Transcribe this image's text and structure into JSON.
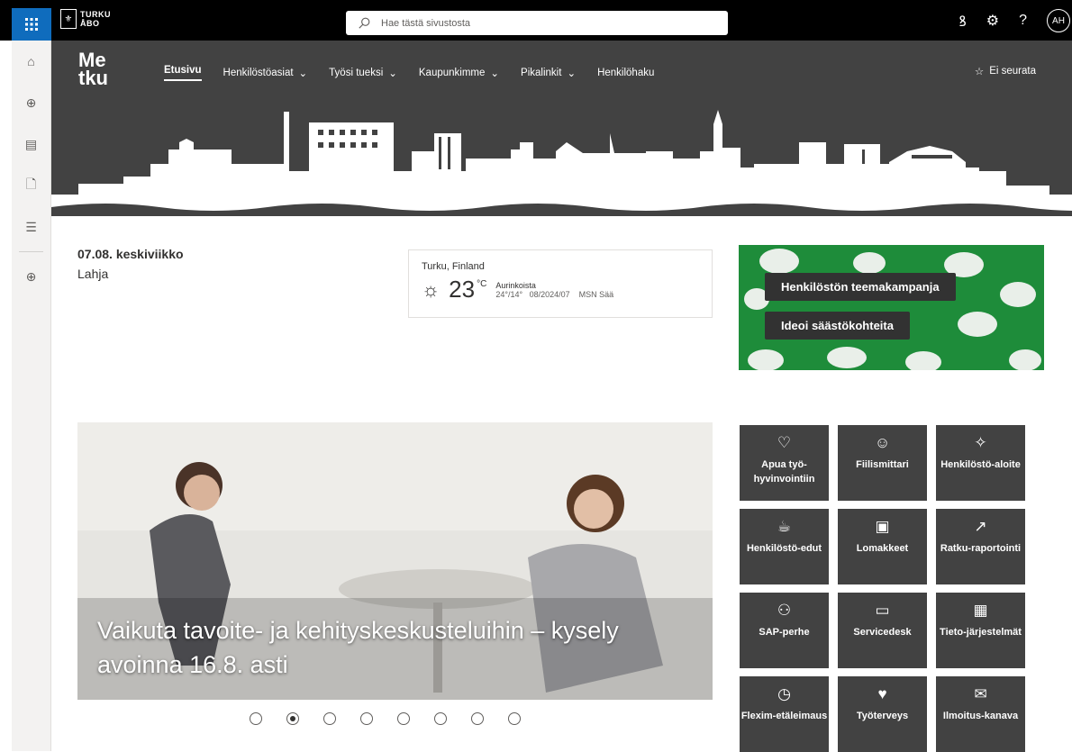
{
  "suitebar": {
    "logo_line1": "TURKU",
    "logo_line2": "ÅBO",
    "search_placeholder": "Hae tästä sivustosta",
    "avatar": "AH",
    "icons": [
      "waffle-icon",
      "sharepoint-icon",
      "settings-icon",
      "help-icon"
    ]
  },
  "leftrail": {
    "icons": [
      "home-icon",
      "globe-icon",
      "news-icon",
      "files-icon",
      "lists-icon",
      "add-icon"
    ]
  },
  "header": {
    "site_logo_line1": "Me",
    "site_logo_line2": "tku",
    "nav": [
      {
        "label": "Etusivu",
        "active": true,
        "dropdown": false
      },
      {
        "label": "Henkilöstöasiat",
        "dropdown": true
      },
      {
        "label": "Työsi tueksi",
        "dropdown": true
      },
      {
        "label": "Kaupunkimme",
        "dropdown": true
      },
      {
        "label": "Pikalinkit",
        "dropdown": true
      },
      {
        "label": "Henkilöhaku",
        "dropdown": false
      }
    ],
    "follow_label": "Ei seurata"
  },
  "date": {
    "date_text": "07.08. keskiviikko",
    "nameday": "Lahja"
  },
  "weather": {
    "location": "Turku, Finland",
    "temperature": "23",
    "unit": "°C",
    "condition": "Aurinkoista",
    "hi_lo": "24°/14°",
    "date": "08/2024/07",
    "source": "MSN Sää"
  },
  "campaign": {
    "title": "Henkilöstön teemakampanja",
    "subtitle": "Ideoi säästökohteita",
    "color": "#1e8c3a"
  },
  "hero": {
    "title": "Vaikuta tavoite- ja kehityskeskusteluihin – kysely avoinna 16.8. asti",
    "slide_count": 8,
    "active_slide": 2
  },
  "tiles": [
    {
      "label": "Apua työ-hyvinvointiin",
      "icon": "heart-icon",
      "glyph": "♡"
    },
    {
      "label": "Fiilismittari",
      "icon": "emoji-icon",
      "glyph": "☺"
    },
    {
      "label": "Henkilöstö-aloite",
      "icon": "lightbulb-icon",
      "glyph": "💡"
    },
    {
      "label": "Henkilöstö-edut",
      "icon": "coffee-icon",
      "glyph": "☕"
    },
    {
      "label": "Lomakkeet",
      "icon": "form-icon",
      "glyph": "🗎"
    },
    {
      "label": "Ratku-raportointi",
      "icon": "chart-icon",
      "glyph": "📈"
    },
    {
      "label": "SAP-perhe",
      "icon": "people-icon",
      "glyph": "👥"
    },
    {
      "label": "Servicedesk",
      "icon": "desktop-icon",
      "glyph": "🖥"
    },
    {
      "label": "Tieto-järjestelmät",
      "icon": "apps-icon",
      "glyph": "▦"
    },
    {
      "label": "Flexim-etäleimaus",
      "icon": "clock-icon",
      "glyph": "🕓"
    },
    {
      "label": "Työterveys",
      "icon": "health-heart-icon",
      "glyph": "♥"
    },
    {
      "label": "Ilmoitus-kanava",
      "icon": "message-icon",
      "glyph": "💬"
    }
  ]
}
